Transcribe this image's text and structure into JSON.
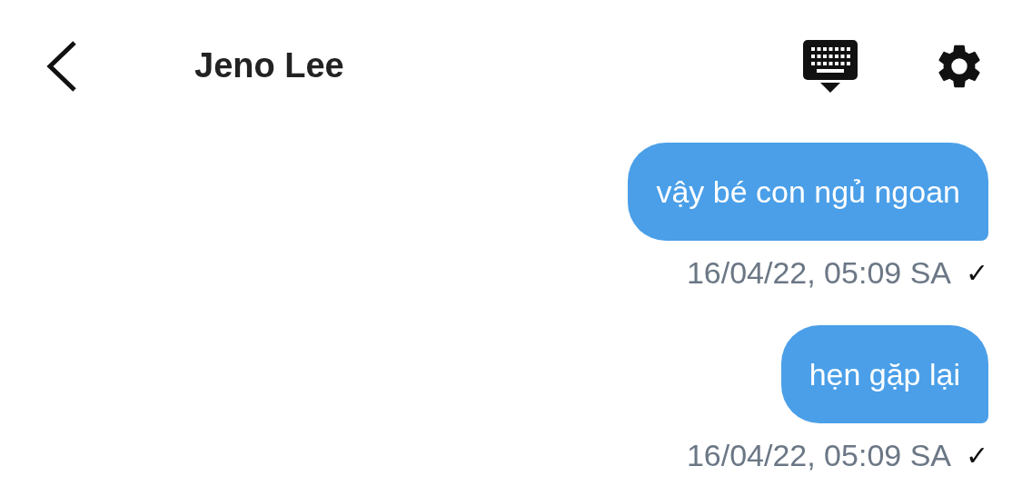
{
  "header": {
    "title": "Jeno Lee"
  },
  "messages": [
    {
      "text": "vậy bé con ngủ ngoan",
      "time": "16/04/22, 05:09 SA",
      "status": "✓"
    },
    {
      "text": "hẹn gặp lại",
      "time": "16/04/22, 05:09 SA",
      "status": "✓"
    }
  ]
}
